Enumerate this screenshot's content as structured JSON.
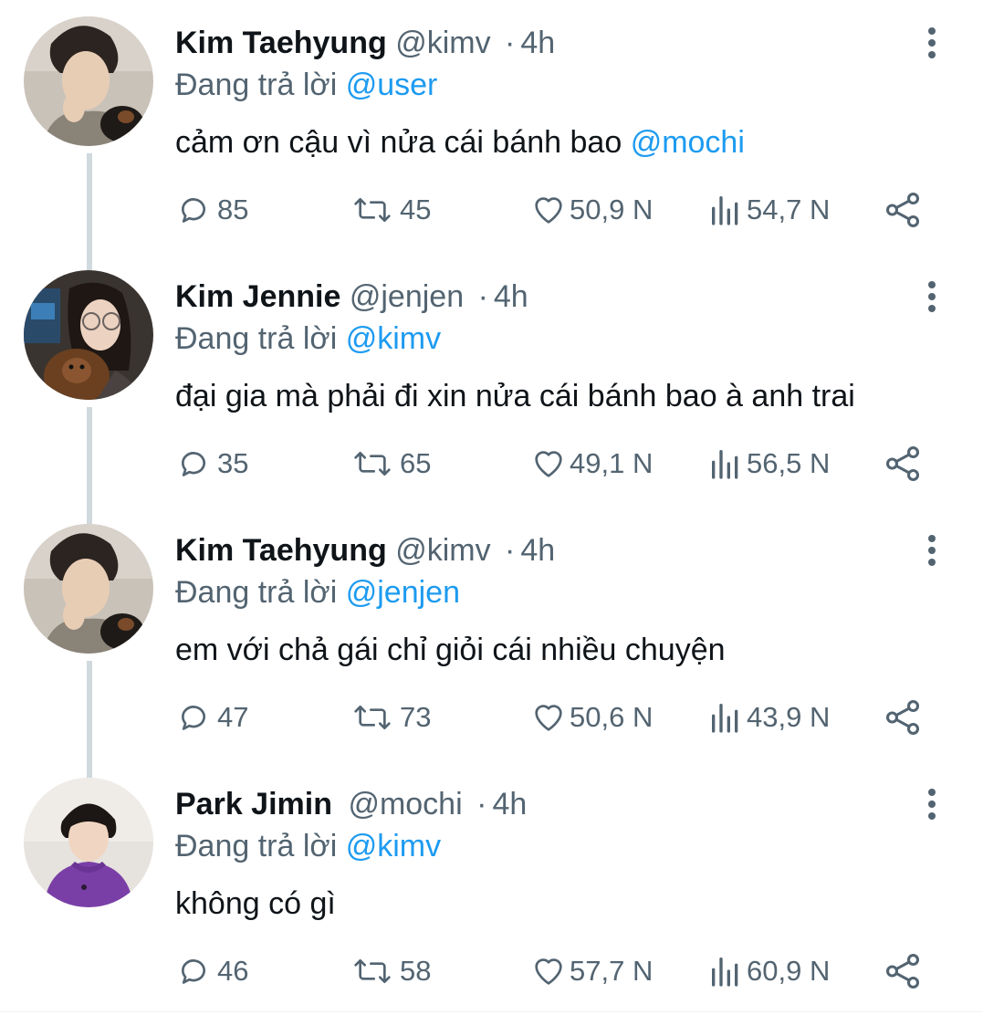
{
  "reply_prefix": "Đang trả lời",
  "tweets": [
    {
      "name": "Kim Taehyung",
      "handle": "@kimv",
      "separator": "·",
      "time": "4h",
      "reply_to": "@user",
      "text": "cảm ơn cậu vì nửa cái bánh bao ",
      "text_mention": "@mochi",
      "replies": "85",
      "retweets": "45",
      "likes": "50,9 N",
      "views": "54,7 N",
      "avatar": "taehyung-avatar"
    },
    {
      "name": "Kim Jennie",
      "handle": "@jenjen",
      "separator": "·",
      "time": "4h",
      "reply_to": "@kimv",
      "text": "đại gia mà phải đi xin nửa cái bánh bao à anh trai",
      "text_mention": "",
      "replies": "35",
      "retweets": "65",
      "likes": "49,1 N",
      "views": "56,5 N",
      "avatar": "jennie-avatar"
    },
    {
      "name": "Kim Taehyung",
      "handle": "@kimv",
      "separator": "·",
      "time": "4h",
      "reply_to": "@jenjen",
      "text": "em với chả gái chỉ giỏi cái nhiều chuyện",
      "text_mention": "",
      "replies": "47",
      "retweets": "73",
      "likes": "50,6 N",
      "views": "43,9 N",
      "avatar": "taehyung-avatar"
    },
    {
      "name": "Park Jimin",
      "handle": "@mochi",
      "separator": "·",
      "time": "4h",
      "reply_to": "@kimv",
      "text": "không có gì",
      "text_mention": "",
      "replies": "46",
      "retweets": "58",
      "likes": "57,7 N",
      "views": "60,9 N",
      "avatar": "jimin-avatar"
    }
  ],
  "icons": {
    "reply": "reply-icon",
    "retweet": "retweet-icon",
    "like": "heart-icon",
    "views": "views-icon",
    "share": "share-icon",
    "more": "more-vertical-icon"
  },
  "colors": {
    "mention": "#1d9bf0",
    "secondary_text": "#536471",
    "primary_text": "#0f1419",
    "thread_line": "#cfd9de"
  }
}
